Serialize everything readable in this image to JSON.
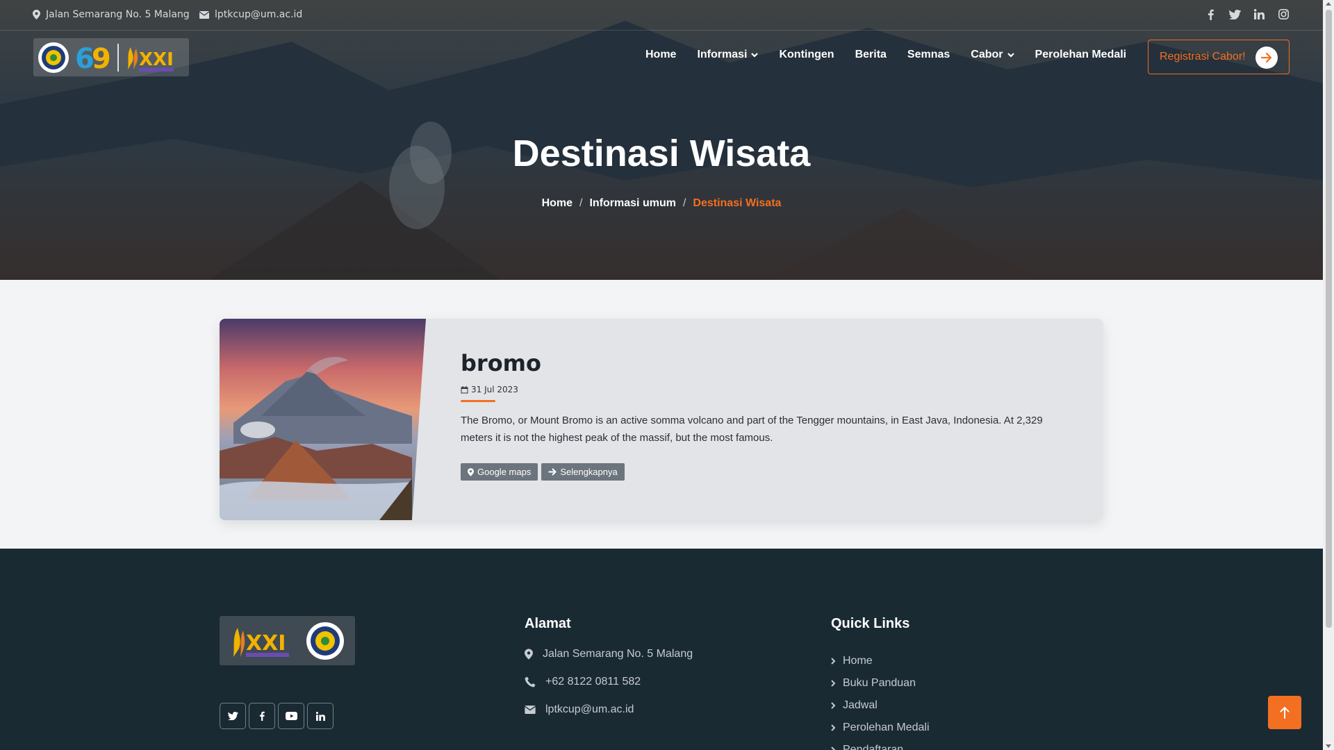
{
  "topbar": {
    "address": "Jalan Semarang No. 5 Malang",
    "email": "lptkcup@um.ac.id",
    "socials": [
      "facebook-icon",
      "twitter-icon",
      "linkedin-icon",
      "instagram-icon"
    ]
  },
  "header": {
    "logo_text": "XXI",
    "nav": [
      {
        "label": "Home"
      },
      {
        "label": "Informasi"
      },
      {
        "label": "Kontingen"
      },
      {
        "label": "Berita"
      },
      {
        "label": "Semnas"
      },
      {
        "label": "Cabor"
      },
      {
        "label": "Perolehan Medali"
      }
    ],
    "register_label": "Registrasi Cabor!"
  },
  "hero": {
    "title": "Destinasi Wisata",
    "breadcrumb": [
      "Home",
      "Informasi umum",
      "Destinasi Wisata"
    ]
  },
  "destination": {
    "title": "bromo",
    "date": "31 Jul 2023",
    "description": "The Bromo, or Mount Bromo is an active somma volcano and part of the Tengger mountains, in East Java, Indonesia. At 2,329 meters it is not the highest peak of the massif, but the most famous.",
    "maps_label": "Google maps",
    "more_label": "Selengkapnya"
  },
  "footer": {
    "logo_text": "XXI",
    "address_title": "Alamat",
    "address": "Jalan Semarang No. 5 Malang",
    "phone": "+62 8122 0811 582",
    "email": "lptkcup@um.ac.id",
    "links_title": "Quick Links",
    "links": [
      "Home",
      "Buku Panduan",
      "Jadwal",
      "Perolehan Medali",
      "Pendaftaran"
    ],
    "socials": [
      "twitter-icon",
      "facebook-icon",
      "youtube-icon",
      "linkedin-icon"
    ]
  },
  "colors": {
    "accent": "#f36f21",
    "footer_bg": "#1a2a33",
    "card_bg": "#e2e4e8"
  }
}
